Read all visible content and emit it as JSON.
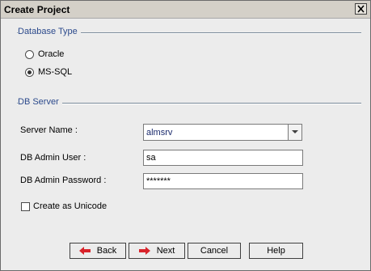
{
  "window": {
    "title": "Create Project"
  },
  "database_type": {
    "section_label": "Database Type",
    "options": [
      {
        "label": "Oracle",
        "selected": false
      },
      {
        "label": "MS-SQL",
        "selected": true
      }
    ]
  },
  "db_server": {
    "section_label": "DB Server",
    "server_name_label": "Server Name :",
    "server_name_value": "almsrv",
    "admin_user_label": "DB Admin User :",
    "admin_user_value": "sa",
    "admin_password_label": "DB Admin Password :",
    "admin_password_value": "*******",
    "unicode_label": "Create as Unicode",
    "unicode_checked": false
  },
  "buttons": {
    "back": "Back",
    "next": "Next",
    "cancel": "Cancel",
    "help": "Help"
  },
  "colors": {
    "section_label": "#2c4a8c",
    "arrow_red": "#d8232a"
  },
  "icons": {
    "close": "close-icon",
    "back": "arrow-left-icon",
    "next": "arrow-right-icon",
    "dropdown": "chevron-down-icon"
  }
}
